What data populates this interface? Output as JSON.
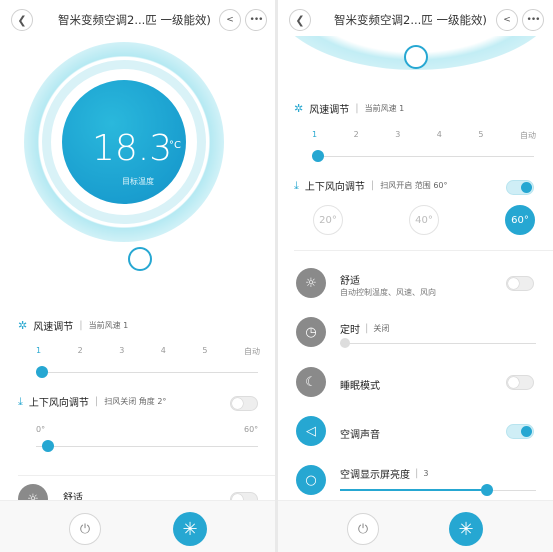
{
  "header": {
    "title": "智米变频空调2...匹 一级能效)"
  },
  "temp": {
    "value": "18.3",
    "unit": "°C",
    "label": "目标温度"
  },
  "fan": {
    "title": "风速调节",
    "subtitle": "当前风速 1",
    "ticks": [
      "1",
      "2",
      "3",
      "4",
      "5",
      "自动"
    ],
    "level": 1
  },
  "vane_left": {
    "title": "上下风向调节",
    "subtitle": "扫风关闭 角度 2°",
    "min": "0°",
    "max": "60°",
    "angle": 2
  },
  "vane_right": {
    "title": "上下风向调节",
    "subtitle": "扫风开启 范围 60°",
    "angles": [
      "20°",
      "40°",
      "60°"
    ],
    "selected": "60°"
  },
  "features": {
    "comfort": {
      "name": "舒适",
      "desc": "自动控制温度、风速、风向"
    },
    "timer": {
      "name": "定时",
      "status": "关闭"
    },
    "sleep": {
      "name": "睡眠模式"
    },
    "sound": {
      "name": "空调声音"
    },
    "brightness": {
      "name": "空调显示屏亮度",
      "value": "3",
      "level_fraction": 0.75
    }
  },
  "colors": {
    "accent": "#26a7d2",
    "grey_icon": "#8a8a8a"
  }
}
